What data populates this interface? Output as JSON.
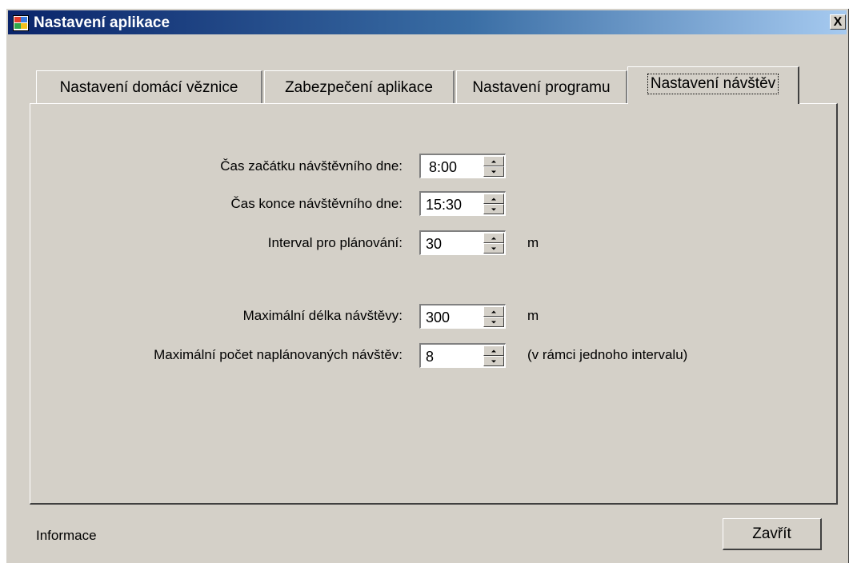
{
  "window": {
    "title": "Nastavení aplikace",
    "close_glyph": "X"
  },
  "tabs": [
    {
      "label": "Nastavení domácí věznice"
    },
    {
      "label": "Zabezpečení aplikace"
    },
    {
      "label": "Nastavení programu"
    },
    {
      "label": "Nastavení návštěv",
      "active": true
    }
  ],
  "form": {
    "start": {
      "label": "Čas začátku návštěvního dne:",
      "value": "8:00"
    },
    "end": {
      "label": "Čas konce návštěvního dne:",
      "value": "15:30"
    },
    "interval": {
      "label": "Interval pro plánování:",
      "value": "30",
      "unit": "m"
    },
    "max_length": {
      "label": "Maximální délka návštěvy:",
      "value": "300",
      "unit": "m"
    },
    "max_count": {
      "label": "Maximální počet naplánovaných návštěv:",
      "value": "8",
      "unit": "(v rámci jednoho intervalu)"
    }
  },
  "footer": {
    "info": "Informace",
    "close_label": "Zavřít"
  },
  "icons": {
    "app": "app-icon",
    "close": "close-icon"
  }
}
